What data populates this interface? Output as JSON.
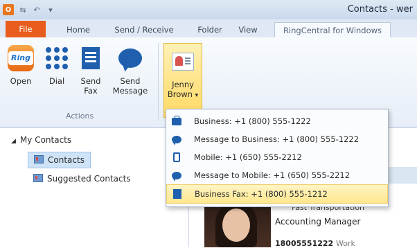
{
  "window": {
    "title": "Contacts - wer"
  },
  "tabs": [
    {
      "label": "File"
    },
    {
      "label": "Home"
    },
    {
      "label": "Send / Receive"
    },
    {
      "label": "Folder"
    },
    {
      "label": "View"
    },
    {
      "label": "RingCentral for Windows"
    }
  ],
  "ribbon": {
    "group_label": "Actions",
    "buttons": [
      {
        "line1": "Open",
        "line2": "",
        "logo_text": "Ring"
      },
      {
        "line1": "Dial",
        "line2": ""
      },
      {
        "line1": "Send",
        "line2": "Fax"
      },
      {
        "line1": "Send",
        "line2": "Message"
      },
      {
        "line1": "Jenny",
        "line2": "Brown",
        "arrow": "▾"
      }
    ]
  },
  "nav": {
    "header": "My Contacts",
    "items": [
      {
        "label": "Contacts",
        "selected": true
      },
      {
        "label": "Suggested Contacts",
        "selected": false
      }
    ]
  },
  "menu": {
    "items": [
      {
        "icon": "briefcase-icon",
        "label": "Business: +1 (800) 555-1222"
      },
      {
        "icon": "chat-bubble-icon",
        "label": "Message to Business: +1 (800) 555-1222"
      },
      {
        "icon": "mobile-phone-icon",
        "label": "Mobile: +1 (650) 555-2212"
      },
      {
        "icon": "chat-bubble-icon",
        "label": "Message to Mobile: +1 (650) 555-2212"
      },
      {
        "icon": "fax-icon",
        "label": "Business Fax: +1 (800) 555-1212",
        "highlighted": true
      }
    ]
  },
  "card": {
    "company": "Fast Transportation",
    "title": "Accounting Manager",
    "phone": "18005551222",
    "phone_type": "Work"
  },
  "colors": {
    "file_tab": "#e85d1d",
    "accent_blue": "#1f5fae",
    "highlight": "#ffe78f"
  }
}
